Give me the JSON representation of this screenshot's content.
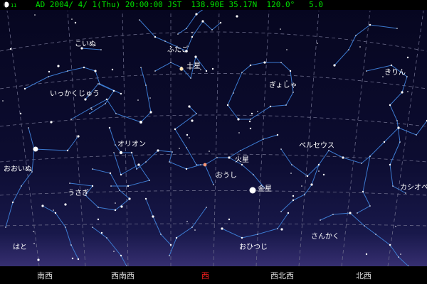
{
  "status": {
    "moon_icon": "moon-phase-icon",
    "moon_age": "11",
    "text": "AD 2004/ 4/ 1(Thu) 20:00:00 JST  138.90E 35.17N  120.0°   5.0"
  },
  "constellations": {
    "koinu": "こいぬ",
    "futago": "ふたご",
    "ikkakujuu": "いっかくじゅう",
    "gyosha": "ぎょしゃ",
    "kirin": "きりん",
    "orion": "オリオン",
    "ooinu": "おおいぬ",
    "ousi": "おうし",
    "perseus": "ペルセウス",
    "usagi": "うさぎ",
    "cassiopeia": "カシオペ",
    "sankaku": "さんかく",
    "ohitsuji": "おひつじ",
    "hato": "はと"
  },
  "planets": {
    "saturn": "土星",
    "mars": "火星",
    "venus": "金星"
  },
  "compass": {
    "south_west": "南西",
    "wsw": "西南西",
    "west": "西",
    "wnw": "西北西",
    "north_west": "北西"
  },
  "colors": {
    "sky": "#0a0a2c",
    "horizon_glow": "#4a3e86",
    "grid": "#6b6b8a",
    "constellation_line": "#3c7ad0",
    "star": "#ffffff",
    "status_text": "#00e000",
    "west_accent": "#ff2020"
  }
}
